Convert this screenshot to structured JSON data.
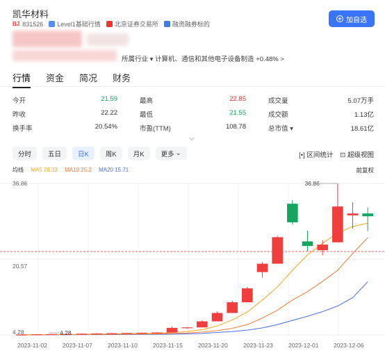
{
  "header": {
    "stock_name": "凯华材料",
    "exchange_badge": "BJ",
    "code": "831526",
    "level1": "Level1基础行情",
    "exchange": "北京证券交易所",
    "margin": "融资融券标的",
    "add_button": "加自选"
  },
  "industry": {
    "text": "所属行业 ▾ 计算机、通信和其他电子设备制造",
    "change": "+0.48%",
    "arrow": ">"
  },
  "tabs": [
    "行情",
    "资金",
    "简况",
    "财务"
  ],
  "quote": {
    "rows": [
      [
        {
          "label": "今开",
          "value": "21.59",
          "color": "green"
        },
        {
          "label": "最高",
          "value": "22.85",
          "color": "red"
        },
        {
          "label": "成交量",
          "value": "5.07万手",
          "color": "dark"
        }
      ],
      [
        {
          "label": "昨收",
          "value": "22.22",
          "color": "dark"
        },
        {
          "label": "最低",
          "value": "21.55",
          "color": "green"
        },
        {
          "label": "成交额",
          "value": "1.13亿",
          "color": "dark"
        }
      ],
      [
        {
          "label": "换手率",
          "value": "20.54%",
          "color": "dark"
        },
        {
          "label": "市盈(TTM)",
          "value": "108.78",
          "color": "dark"
        },
        {
          "label": "总市值 ▾",
          "value": "18.61亿",
          "color": "dark"
        }
      ]
    ]
  },
  "periods": [
    "分时",
    "五日",
    "日K",
    "周K",
    "月K",
    "更多"
  ],
  "active_period": "日K",
  "tools": {
    "interval": "区间统计",
    "super_view": "超级视图"
  },
  "ma": {
    "label": "均线",
    "ma5": "MA5 28.33",
    "ma10": "MA10 25.2",
    "ma20": "MA20 15.71",
    "fq": "前复权"
  },
  "colors": {
    "up": "#f03d3d",
    "down": "#14a660",
    "ma5": "#f5a623",
    "ma10": "#f07c3a",
    "ma20": "#4a6fe3",
    "accent": "#3975f6"
  },
  "chart_data": {
    "type": "candlestick",
    "y_labels": {
      "max": "36.86",
      "mid": "20.57",
      "min": "4.28"
    },
    "max_marker": "36.86",
    "min_marker": "4.28",
    "ylim": [
      4.28,
      36.86
    ],
    "prev_close": 22.22,
    "x_labels": [
      "2023-11-02",
      "2023-11-07",
      "2023-11-10",
      "2023-11-15",
      "2023-11-20",
      "2023-11-23",
      "2023-12-01",
      "2023-12-06"
    ],
    "candles": [
      {
        "o": 4.3,
        "c": 4.35,
        "h": 4.4,
        "l": 4.28
      },
      {
        "o": 4.35,
        "c": 4.4,
        "h": 4.45,
        "l": 4.3
      },
      {
        "o": 4.4,
        "c": 4.45,
        "h": 4.5,
        "l": 4.35
      },
      {
        "o": 4.45,
        "c": 4.5,
        "h": 4.55,
        "l": 4.4
      },
      {
        "o": 4.5,
        "c": 4.55,
        "h": 4.6,
        "l": 4.45
      },
      {
        "o": 4.55,
        "c": 4.6,
        "h": 4.65,
        "l": 4.5
      },
      {
        "o": 4.6,
        "c": 4.65,
        "h": 4.7,
        "l": 4.55
      },
      {
        "o": 4.65,
        "c": 4.7,
        "h": 4.75,
        "l": 4.6
      },
      {
        "o": 4.7,
        "c": 4.75,
        "h": 4.8,
        "l": 4.65
      },
      {
        "o": 4.75,
        "c": 4.8,
        "h": 4.85,
        "l": 4.7
      },
      {
        "o": 4.8,
        "c": 5.8,
        "h": 6.1,
        "l": 4.8
      },
      {
        "o": 5.8,
        "c": 5.9,
        "h": 6.0,
        "l": 5.6
      },
      {
        "o": 5.9,
        "c": 7.2,
        "h": 7.4,
        "l": 5.9
      },
      {
        "o": 7.2,
        "c": 9.0,
        "h": 9.3,
        "l": 7.2
      },
      {
        "o": 9.0,
        "c": 11.3,
        "h": 11.6,
        "l": 9.0
      },
      {
        "o": 11.3,
        "c": 14.3,
        "h": 14.6,
        "l": 11.3
      },
      {
        "o": 17.8,
        "c": 19.6,
        "h": 20.0,
        "l": 16.6
      },
      {
        "o": 19.6,
        "c": 25.3,
        "h": 25.6,
        "l": 19.6
      },
      {
        "o": 32.5,
        "c": 28.5,
        "h": 33.3,
        "l": 28.0
      },
      {
        "o": 24.4,
        "c": 23.4,
        "h": 26.7,
        "l": 22.3
      },
      {
        "o": 22.5,
        "c": 23.7,
        "h": 24.6,
        "l": 21.4
      },
      {
        "o": 24.2,
        "c": 31.9,
        "h": 36.86,
        "l": 24.2
      },
      {
        "o": 30.0,
        "c": 30.4,
        "h": 32.8,
        "l": 27.1
      },
      {
        "o": 30.4,
        "c": 29.8,
        "h": 31.7,
        "l": 26.6
      }
    ],
    "ma5": [
      4.3,
      4.32,
      4.35,
      4.38,
      4.42,
      4.46,
      4.5,
      4.54,
      4.58,
      4.62,
      4.8,
      5.0,
      5.4,
      6.2,
      7.5,
      9.2,
      11.8,
      14.6,
      18.2,
      21.5,
      24.0,
      26.2,
      27.6,
      28.33
    ],
    "ma10": [
      4.3,
      4.31,
      4.33,
      4.35,
      4.37,
      4.39,
      4.42,
      4.45,
      4.48,
      4.51,
      4.6,
      4.7,
      4.9,
      5.2,
      5.7,
      6.5,
      7.9,
      9.6,
      11.8,
      13.6,
      15.8,
      18.2,
      21.8,
      25.2
    ],
    "ma20": [
      4.3,
      4.3,
      4.31,
      4.32,
      4.33,
      4.34,
      4.35,
      4.37,
      4.39,
      4.41,
      4.45,
      4.5,
      4.6,
      4.8,
      5.0,
      5.3,
      5.8,
      6.5,
      7.4,
      8.3,
      9.3,
      10.5,
      12.3,
      15.71
    ]
  }
}
